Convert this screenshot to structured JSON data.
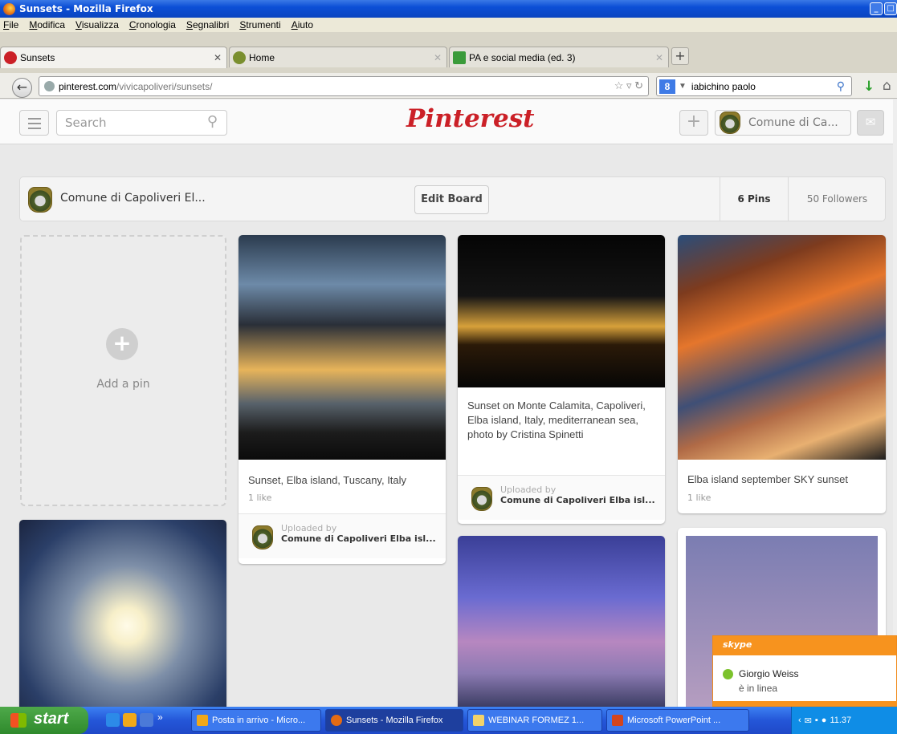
{
  "window": {
    "title": "Sunsets - Mozilla Firefox"
  },
  "menu": [
    "File",
    "Modifica",
    "Visualizza",
    "Cronologia",
    "Segnalibri",
    "Strumenti",
    "Aiuto"
  ],
  "tabs": [
    {
      "label": "Sunsets"
    },
    {
      "label": "Home"
    },
    {
      "label": "PA e social media (ed. 3)"
    }
  ],
  "address": {
    "host": "pinterest.com",
    "path": "/vivicapoliveri/sunsets/"
  },
  "browser_search": {
    "value": "iabichino paolo",
    "engine_icon": "google-icon"
  },
  "pinterest": {
    "search_placeholder": "Search",
    "logo": "Pinterest",
    "user": "Comune di Ca...",
    "board_name": "Comune di Capoliveri El...",
    "edit_board": "Edit Board",
    "pins_count": "6 Pins",
    "followers_count": "50 Followers",
    "add_pin": "Add a pin"
  },
  "pins": [
    {
      "desc": "Sunset, Elba island, Tuscany, Italy",
      "likes": "1 like",
      "uploaded_label": "Uploaded by",
      "uploader": "Comune di Capoliveri Elba isl..."
    },
    {
      "desc": "Sunset on Monte Calamita, Capoliveri, Elba island, Italy, mediterranean sea, photo by Cristina Spinetti",
      "uploaded_label": "Uploaded by",
      "uploader": "Comune di Capoliveri Elba isl..."
    },
    {
      "desc": "Elba island september SKY sunset",
      "likes": "1 like"
    }
  ],
  "skype": {
    "brand": "skype",
    "contact": "Giorgio Weiss",
    "status": "è in linea"
  },
  "taskbar": {
    "start": "start",
    "items": [
      "Posta in arrivo - Micro...",
      "Sunsets - Mozilla Firefox",
      "WEBINAR FORMEZ 1...",
      "Microsoft PowerPoint ..."
    ],
    "clock": "11.37"
  }
}
